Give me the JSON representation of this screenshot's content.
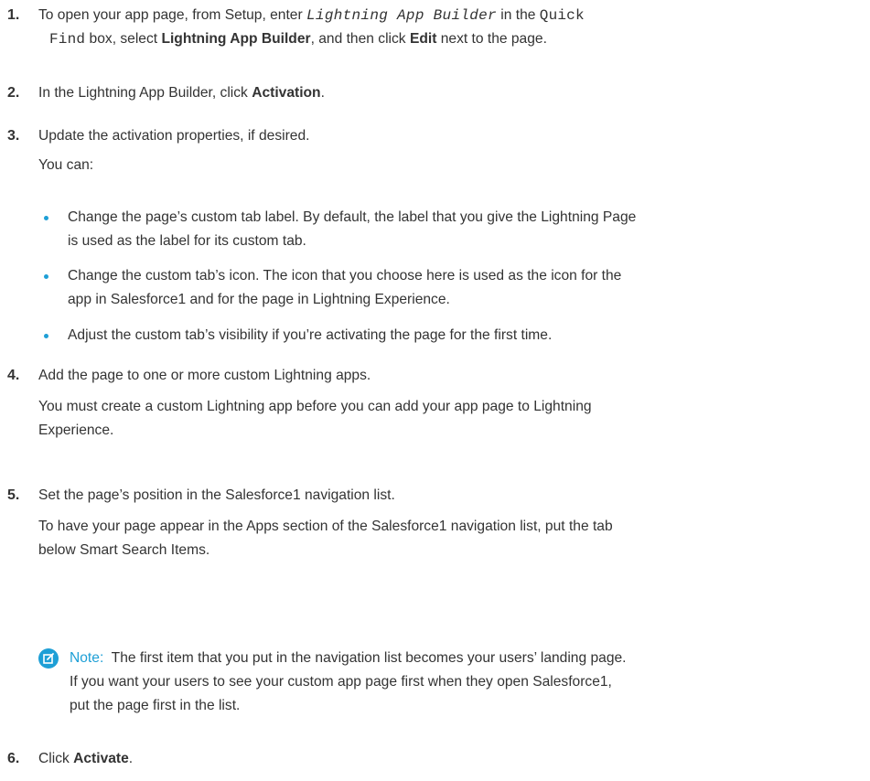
{
  "steps": [
    {
      "number": "1.",
      "a": "To open your app page, from Setup, enter ",
      "code1": "Lightning App Builder",
      "b": " in the ",
      "code2a": "Quick",
      "code2b": "Find",
      "c": " box, select ",
      "bold1": "Lightning App Builder",
      "d": ", and then click ",
      "bold2": "Edit",
      "e": " next to the page."
    },
    {
      "number": "2.",
      "a": "In the Lightning App Builder, click ",
      "bold1": "Activation",
      "e": "."
    },
    {
      "number": "3.",
      "text": "Update the activation properties, if desired.",
      "sub": "You can:",
      "bullets": [
        {
          "line1": "Change the page’s custom tab label. By default, the label that you give the Lightning Page",
          "line2": "is used as the label for its custom tab."
        },
        {
          "line1": "Change the custom tab’s icon. The icon that you choose here is used as the icon for the",
          "line2": "app in Salesforce1 and for the page in Lightning Experience."
        },
        {
          "line1": "Adjust the custom tab’s visibility if you’re activating the page for the first time.",
          "line2": ""
        }
      ]
    },
    {
      "number": "4.",
      "text": "Add the page to one or more custom Lightning apps.",
      "sub1": "You must create a custom Lightning app before you can add your app page to Lightning",
      "sub2": "Experience."
    },
    {
      "number": "5.",
      "text": "Set the page’s position in the Salesforce1 navigation list.",
      "sub1": "To have your page appear in the Apps section of the Salesforce1 navigation list, put the tab",
      "sub2": "below Smart Search Items.",
      "note": {
        "icon": "edit-note-icon",
        "label": "Note:",
        "line1": "The first item that you put in the navigation list becomes your users’ landing page.",
        "line2": "If you want your users to see your custom app page first when they open Salesforce1,",
        "line3": "put the page first in the list."
      }
    },
    {
      "number": "6.",
      "a": "Click ",
      "bold1": "Activate",
      "e": "."
    }
  ],
  "colors": {
    "accent": "#1e9fd6",
    "text": "#333333"
  }
}
